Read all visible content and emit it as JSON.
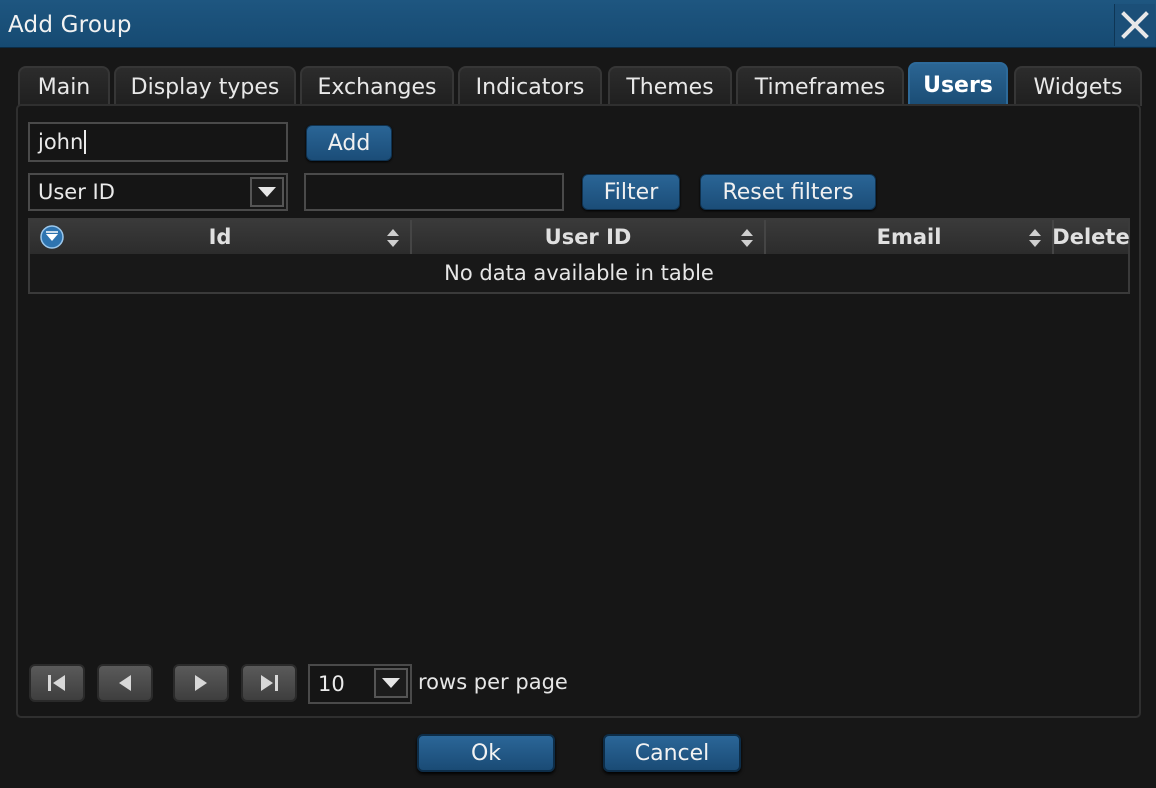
{
  "window": {
    "title": "Add Group"
  },
  "colors": {
    "titlebar": "#1e5680",
    "accent": "#2a6596",
    "background": "#171717"
  },
  "tabs": [
    {
      "label": "Main"
    },
    {
      "label": "Display types"
    },
    {
      "label": "Exchanges"
    },
    {
      "label": "Indicators"
    },
    {
      "label": "Themes"
    },
    {
      "label": "Timeframes"
    },
    {
      "label": "Users",
      "active": true
    },
    {
      "label": "Widgets"
    }
  ],
  "add_user": {
    "value": "john",
    "button_label": "Add"
  },
  "filter": {
    "field_selected": "User ID",
    "value": "",
    "filter_label": "Filter",
    "reset_label": "Reset filters"
  },
  "table": {
    "columns": [
      "Id",
      "User ID",
      "Email",
      "Delete"
    ],
    "empty_message": "No data available in table"
  },
  "pagination": {
    "rows_per_page": "10",
    "rows_label": "rows per page",
    "icons": [
      "first-page-icon",
      "prev-page-icon",
      "next-page-icon",
      "last-page-icon"
    ]
  },
  "footer": {
    "ok_label": "Ok",
    "cancel_label": "Cancel"
  }
}
